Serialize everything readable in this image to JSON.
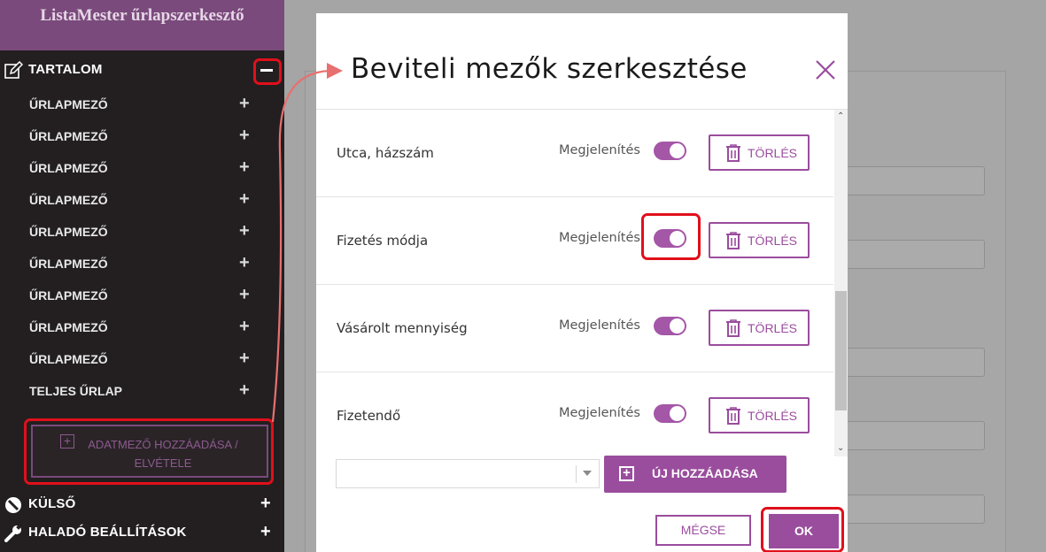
{
  "sidebar": {
    "title": "ListaMester űrlapszerkesztő",
    "sections": {
      "tartalom": {
        "label": "TARTALOM"
      },
      "kulso": {
        "label": "KÜLSŐ"
      },
      "halado": {
        "label": "HALADÓ BEÁLLÍTÁSOK"
      }
    },
    "items": [
      {
        "label": "ŰRLAPMEZŐ"
      },
      {
        "label": "ŰRLAPMEZŐ"
      },
      {
        "label": "ŰRLAPMEZŐ"
      },
      {
        "label": "ŰRLAPMEZŐ"
      },
      {
        "label": "ŰRLAPMEZŐ"
      },
      {
        "label": "ŰRLAPMEZŐ"
      },
      {
        "label": "ŰRLAPMEZŐ"
      },
      {
        "label": "ŰRLAPMEZŐ"
      },
      {
        "label": "ŰRLAPMEZŐ"
      },
      {
        "label": "TELJES ŰRLAP"
      }
    ],
    "add_field": {
      "line1": "ADATMEZŐ HOZZÁADÁSA /",
      "line2": "ELVÉTELE"
    }
  },
  "modal": {
    "title": "Beviteli mezők szerkesztése",
    "show_label": "Megjelenítés",
    "delete_label": "TÖRLÉS",
    "fields": [
      {
        "name": "Utca, házszám",
        "visible": true
      },
      {
        "name": "Fizetés módja",
        "visible": true
      },
      {
        "name": "Vásárolt mennyiség",
        "visible": true
      },
      {
        "name": "Fizetendő",
        "visible": true
      }
    ],
    "select_value": "",
    "add_new_label": "ÚJ HOZZÁADÁSA",
    "cancel_label": "MÉGSE",
    "ok_label": "OK"
  },
  "colors": {
    "accent": "#9a4d9d",
    "sidebar_bg": "#231f20",
    "sidebar_header": "#7a4a7c",
    "highlight": "#e0101b"
  }
}
